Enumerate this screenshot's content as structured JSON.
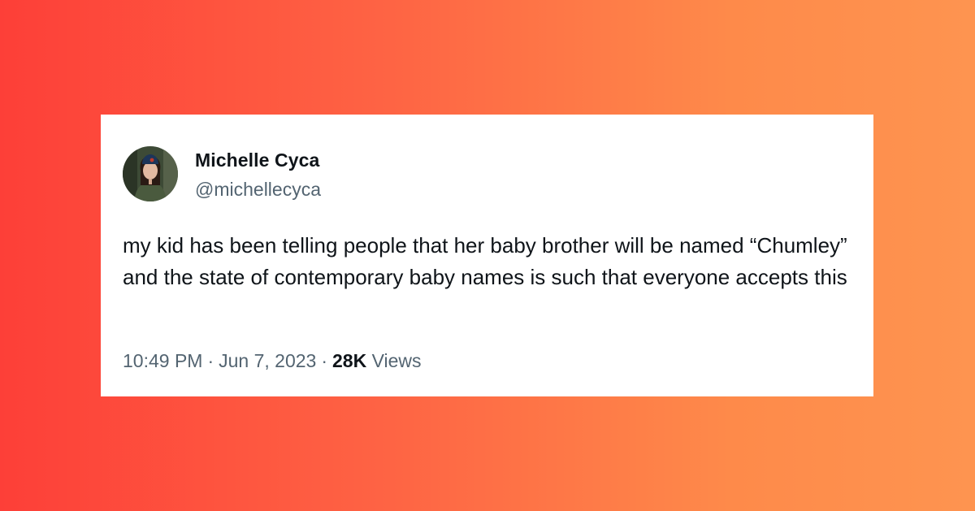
{
  "tweet": {
    "author": {
      "display_name": "Michelle Cyca",
      "handle": "@michellecyca",
      "avatar_icon": "profile-photo"
    },
    "text": "my kid has been telling people that her baby brother will be named “Chumley” and the state of contemporary baby names is such that everyone accepts this",
    "time": "10:49 PM",
    "separator": "·",
    "date": "Jun 7, 2023",
    "views_count": "28K",
    "views_label": "Views"
  },
  "colors": {
    "background_gradient_start": "#fd3f38",
    "background_gradient_end": "#fe9450",
    "card_background": "#ffffff",
    "primary_text": "#0f1419",
    "secondary_text": "#536471"
  }
}
